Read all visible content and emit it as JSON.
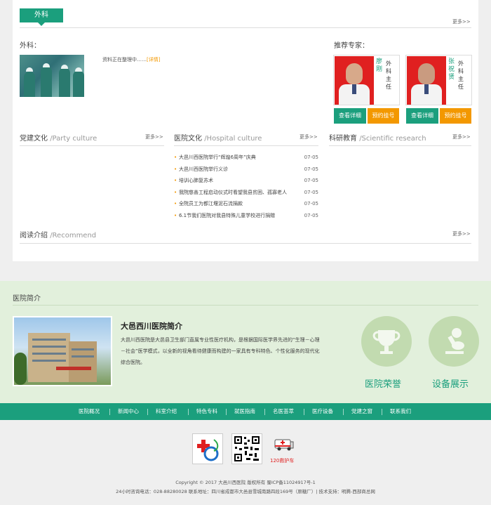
{
  "surgery": {
    "tab": "外科",
    "more": "更多>>",
    "heading": "外科：",
    "message": "资料正在整理中……",
    "detail_link": "[详情]"
  },
  "experts": {
    "heading": "推荐专家：",
    "doctors": [
      {
        "name": "廖刚",
        "title": "外科主任",
        "detail_btn": "查看详细",
        "book_btn": "预约挂号"
      },
      {
        "name": "张祝贤",
        "title": "外科主任",
        "detail_btn": "查看详细",
        "book_btn": "预约挂号"
      }
    ]
  },
  "party": {
    "title": "党建文化",
    "en": "/Party culture",
    "more": "更多>>"
  },
  "culture": {
    "title": "医院文化",
    "en": "/Hospital culture",
    "more": "更多>>",
    "items": [
      {
        "text": "大邑川西医院举行“辉煌6周年”庆典",
        "date": "07-05"
      },
      {
        "text": "大邑川西医院举行义诊",
        "date": "07-05"
      },
      {
        "text": "培训心肺复苏术",
        "date": "07-05"
      },
      {
        "text": "我院慈善工程启动仪式时看望我县贫困、孤寡老人",
        "date": "07-05"
      },
      {
        "text": "全院员工为都江堰泥石流捐款",
        "date": "07-05"
      },
      {
        "text": "6.1节我们医院对我县特殊儿童学校进行捐赠",
        "date": "07-05"
      }
    ]
  },
  "research": {
    "title": "科研教育",
    "en": "/Scientific research",
    "more": "更多>>"
  },
  "recommend": {
    "title": "阅读介绍",
    "en": "/Recommend",
    "more": "更多>>"
  },
  "intro": {
    "section_title": "医院简介",
    "heading": "大邑西川医院简介",
    "paragraph": "大邑川西医院是大邑县卫生部门直属专业性医疗机构，是根据国际医学界先进的“生理－心理－社会”医学模式，以全新的视角看待健康而构建的一家具有专科特色、个性化服务的现代化综合医院。",
    "honor_label": "医院荣誉",
    "equipment_label": "设备展示"
  },
  "nav": [
    "医院概况",
    "新闻中心",
    "科室介绍",
    "特色专科",
    "就医指南",
    "名医荟萃",
    "医疗设备",
    "党建之窗",
    "联系我们"
  ],
  "footer": {
    "ambulance": "120救护车",
    "copyright": "Copyright © 2017 大邑川西医院 版权所有 蜀ICP备11024917号-1",
    "contact": "24小时咨询电话：028-88280028 联系地址：四川省成都市大邑县雪城南路四段169号（原糖厂）| 技术支持：明腾-西部商总网"
  },
  "colors": {
    "accent": "#1b9f7d",
    "orange": "#f39800",
    "intro_bg": "#e2f0dc"
  }
}
